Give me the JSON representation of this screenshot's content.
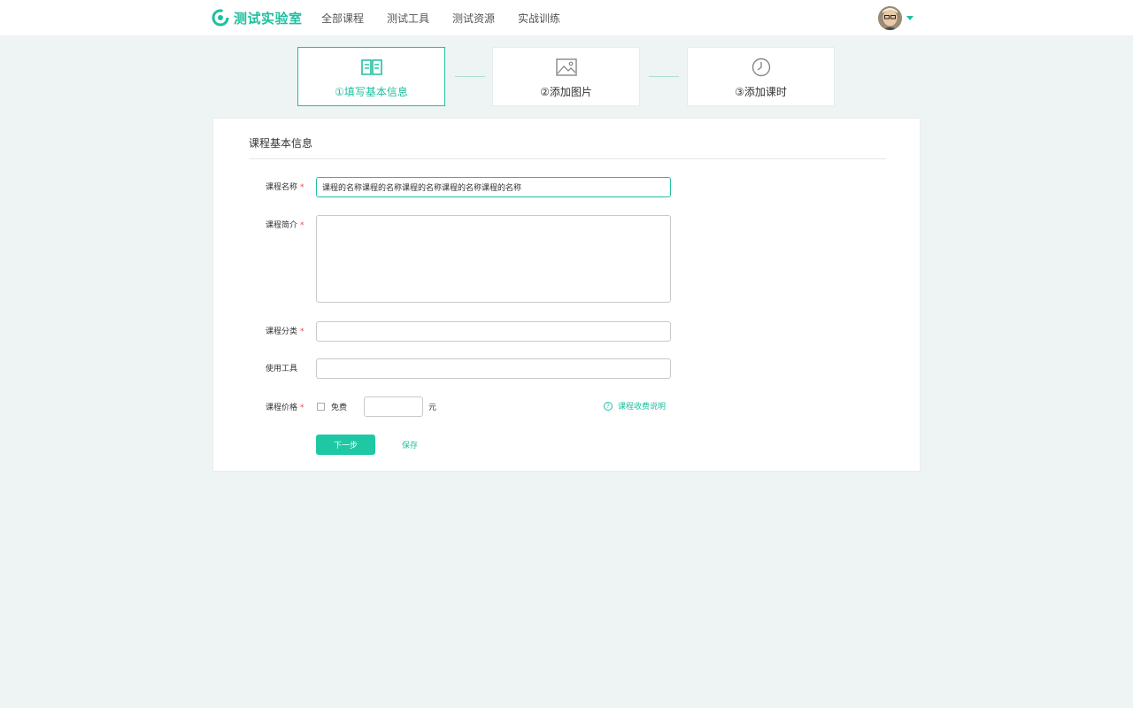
{
  "brand": {
    "name": "测试实验室",
    "color": "#1fbf9f"
  },
  "nav": [
    {
      "label": "全部课程"
    },
    {
      "label": "测试工具"
    },
    {
      "label": "测试资源"
    },
    {
      "label": "实战训练"
    }
  ],
  "steps": [
    {
      "label": "①填写基本信息",
      "icon": "book-icon",
      "active": true
    },
    {
      "label": "②添加图片",
      "icon": "image-icon",
      "active": false
    },
    {
      "label": "③添加课时",
      "icon": "clock-icon",
      "active": false
    }
  ],
  "form": {
    "title": "课程基本信息",
    "required_mark": "*",
    "name": {
      "label": "课程名称",
      "value": "课程的名称课程的名称课程的名称课程的名称课程的名称"
    },
    "intro": {
      "label": "课程简介",
      "value": ""
    },
    "category": {
      "label": "课程分类",
      "value": ""
    },
    "tools": {
      "label": "使用工具",
      "value": ""
    },
    "price": {
      "label": "课程价格",
      "free_label": "免费",
      "value": "",
      "unit": "元",
      "help_label": "课程收费说明",
      "help_icon": "question-circle-icon"
    },
    "next_label": "下一步",
    "save_label": "保存"
  }
}
